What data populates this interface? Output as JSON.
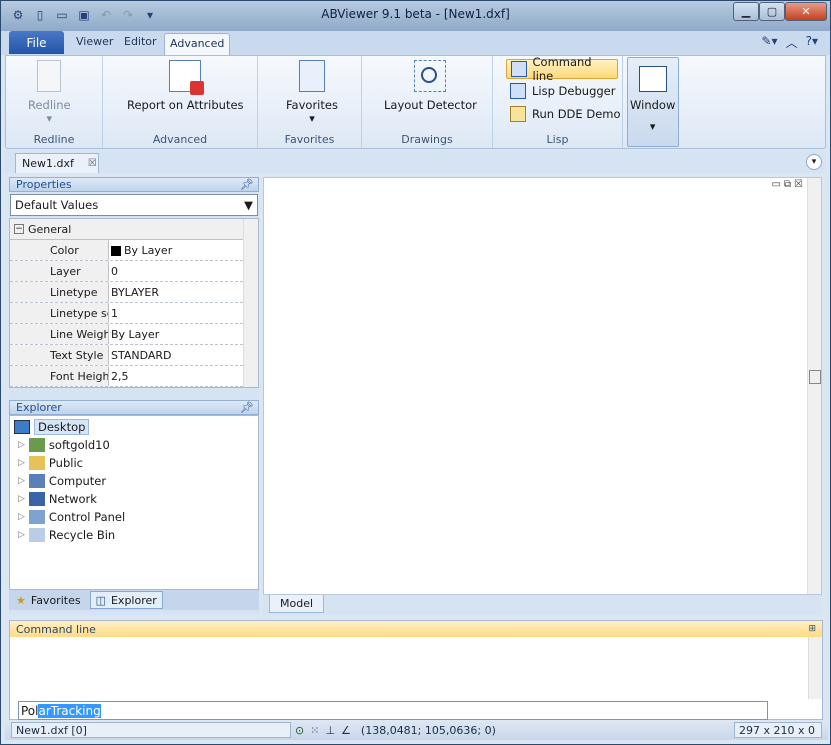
{
  "window": {
    "title": "ABViewer 9.1 beta - [New1.dxf]"
  },
  "ribbon_tabs": {
    "file": "File",
    "viewer": "Viewer",
    "editor": "Editor",
    "advanced": "Advanced"
  },
  "groups": {
    "redline": {
      "button": "Redline",
      "label": "Redline"
    },
    "advanced": {
      "button": "Report on Attributes",
      "label": "Advanced"
    },
    "favorites": {
      "button": "Favorites",
      "label": "Favorites"
    },
    "drawings": {
      "button": "Layout Detector",
      "label": "Drawings"
    },
    "lisp": {
      "command_line": "Command line",
      "debugger": "Lisp Debugger",
      "dde": "Run DDE Demo",
      "label": "Lisp"
    },
    "window": {
      "button": "Window"
    }
  },
  "document_tab": "New1.dxf",
  "properties": {
    "title": "Properties",
    "selector": "Default Values",
    "section": "General",
    "rows": [
      {
        "name": "Color",
        "value": "By Layer"
      },
      {
        "name": "Layer",
        "value": "0"
      },
      {
        "name": "Linetype",
        "value": "BYLAYER"
      },
      {
        "name": "Linetype sca",
        "value": "1"
      },
      {
        "name": "Line Weight",
        "value": "By Layer"
      },
      {
        "name": "Text Style",
        "value": "STANDARD"
      },
      {
        "name": "Font Height",
        "value": "2,5"
      }
    ]
  },
  "explorer": {
    "title": "Explorer",
    "root": "Desktop",
    "items": [
      "softgold10",
      "Public",
      "Computer",
      "Network",
      "Control Panel",
      "Recycle Bin"
    ],
    "tabs": {
      "favorites": "Favorites",
      "explorer": "Explorer"
    }
  },
  "model_tab": "Model",
  "command": {
    "title": "Command line",
    "input_before": "Pol",
    "input_selected": "arTracking"
  },
  "status": {
    "file": "New1.dxf [0]",
    "coords": "(138,0481; 105,0636; 0)",
    "size": "297 x 210 x 0"
  }
}
